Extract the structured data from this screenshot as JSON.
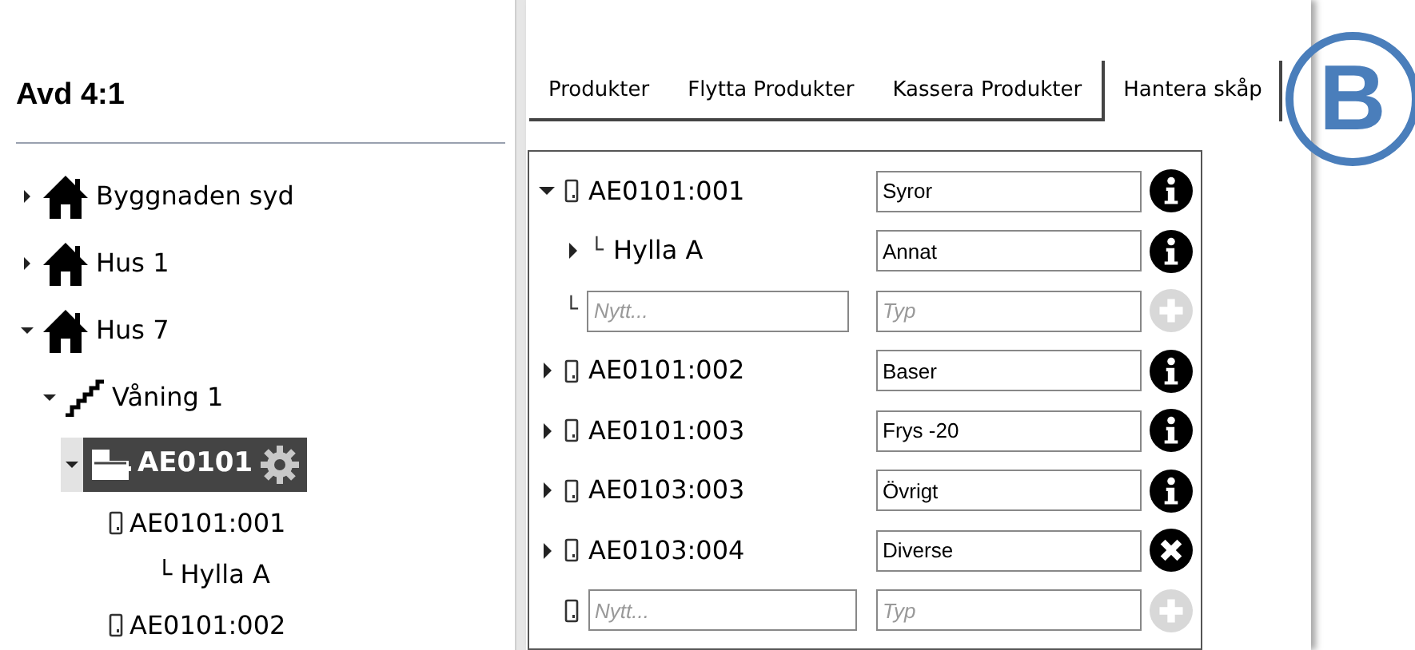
{
  "sidebar": {
    "title": "Avd 4:1",
    "tree": [
      {
        "kind": "building",
        "label": "Byggnaden syd",
        "expanded": false,
        "selected": false
      },
      {
        "kind": "building",
        "label": "Hus 1",
        "expanded": false,
        "selected": false
      },
      {
        "kind": "building",
        "label": "Hus 7",
        "expanded": true,
        "selected": false,
        "children": [
          {
            "kind": "floor",
            "label": "Våning 1",
            "expanded": true,
            "selected": false,
            "children": [
              {
                "kind": "cabinet",
                "label": "AE0101",
                "expanded": true,
                "selected": true,
                "children": [
                  {
                    "kind": "compartment",
                    "label": "AE0101:001",
                    "selected": false,
                    "children": [
                      {
                        "kind": "shelf",
                        "label": "└ Hylla A",
                        "selected": false
                      }
                    ]
                  },
                  {
                    "kind": "compartment",
                    "label": "AE0101:002",
                    "selected": false
                  }
                ]
              }
            ]
          }
        ]
      }
    ]
  },
  "tabs": [
    {
      "label": "Produkter",
      "selected": false
    },
    {
      "label": "Flytta Produkter",
      "selected": false
    },
    {
      "label": "Kassera Produkter",
      "selected": false
    },
    {
      "label": "Hantera skåp",
      "selected": true
    }
  ],
  "rows": [
    {
      "kind": "compartment",
      "label": "AE0101:001",
      "expanded": true,
      "type": "Syror",
      "action": {
        "kind": "info"
      },
      "children": [
        {
          "kind": "shelf",
          "prefix": "└",
          "label": "Hylla A",
          "expanded": false,
          "type": "Annat",
          "action": {
            "kind": "info"
          }
        },
        {
          "kind": "new_shelf",
          "prefix": "└",
          "placeholder": "Nytt...",
          "type_placeholder": "Typ",
          "action": {
            "kind": "add"
          }
        }
      ]
    },
    {
      "kind": "compartment",
      "label": "AE0101:002",
      "expanded": false,
      "type": "Baser",
      "action": {
        "kind": "info"
      }
    },
    {
      "kind": "compartment",
      "label": "AE0101:003",
      "expanded": false,
      "type": "Frys -20",
      "action": {
        "kind": "info"
      }
    },
    {
      "kind": "compartment",
      "label": "AE0103:003",
      "expanded": false,
      "type": "Övrigt",
      "action": {
        "kind": "info"
      }
    },
    {
      "kind": "compartment",
      "label": "AE0103:004",
      "expanded": false,
      "type": "Diverse",
      "action": {
        "kind": "remove"
      }
    },
    {
      "kind": "new_compartment",
      "placeholder": "Nytt...",
      "type_placeholder": "Typ",
      "action": {
        "kind": "add"
      }
    }
  ],
  "badge": "B"
}
